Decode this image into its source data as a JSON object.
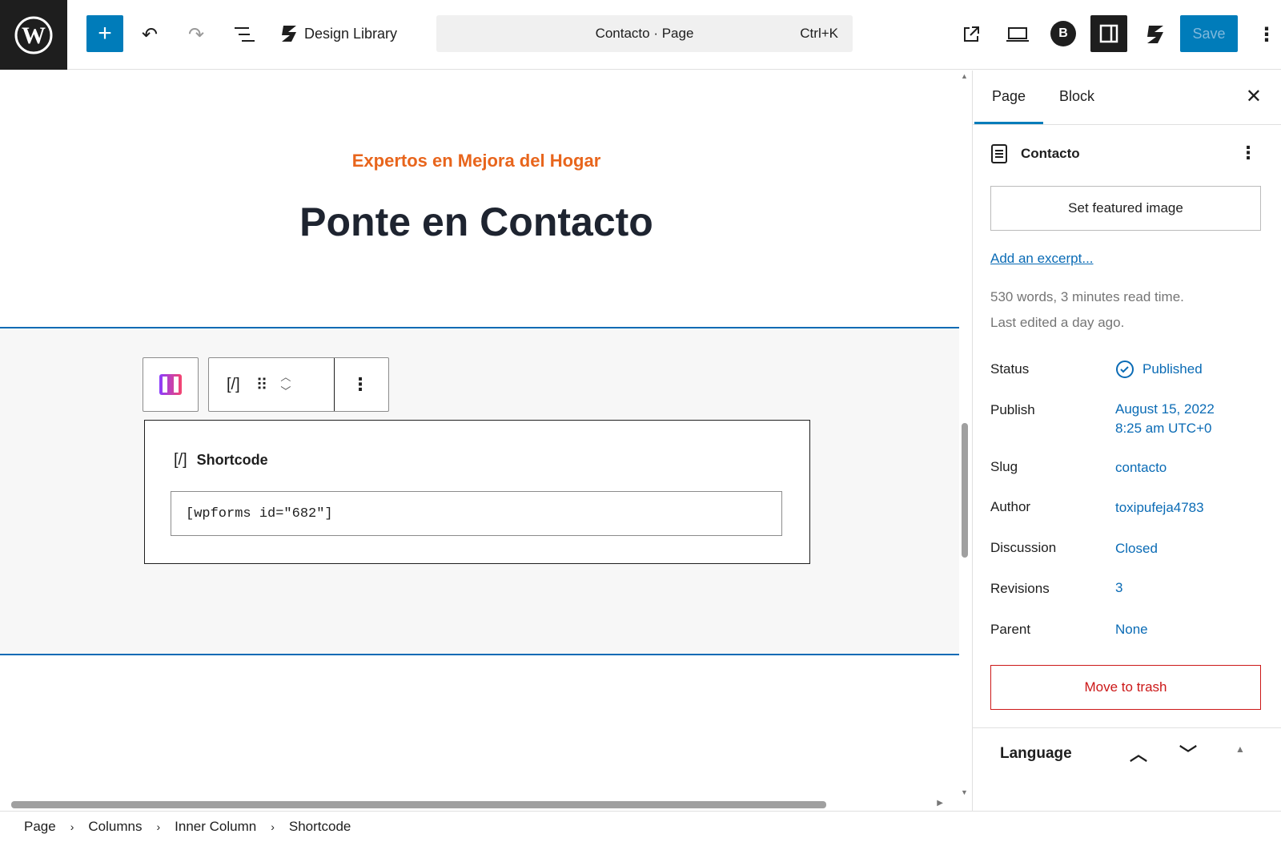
{
  "topbar": {
    "design_library": "Design Library",
    "command_title": "Contacto · Page",
    "shortcut": "Ctrl+K",
    "save": "Save"
  },
  "canvas": {
    "eyebrow": "Expertos en Mejora del Hogar",
    "heading": "Ponte en Contacto",
    "shortcode_label": "Shortcode",
    "shortcode_glyph": "[/]",
    "shortcode_value": "[wpforms id=\"682\"]"
  },
  "sidebar": {
    "tabs": [
      "Page",
      "Block"
    ],
    "title": "Contacto",
    "featured": "Set featured image",
    "excerpt": "Add an excerpt...",
    "stats": "530 words, 3 minutes read time.",
    "edited": "Last edited a day ago.",
    "fields": [
      {
        "label": "Status",
        "value": "Published"
      },
      {
        "label": "Publish",
        "value": "August 15, 2022",
        "value2": "8:25 am UTC+0"
      },
      {
        "label": "Slug",
        "value": "contacto"
      },
      {
        "label": "Author",
        "value": "toxipufeja4783"
      },
      {
        "label": "Discussion",
        "value": "Closed"
      },
      {
        "label": "Revisions",
        "value": "3"
      },
      {
        "label": "Parent",
        "value": "None"
      }
    ],
    "trash": "Move to trash",
    "language": "Language"
  },
  "breadcrumbs": [
    "Page",
    "Columns",
    "Inner Column",
    "Shortcode"
  ],
  "colors": {
    "accent": "#007cba",
    "eyebrow": "#e8651c",
    "trash": "#cc1818"
  }
}
